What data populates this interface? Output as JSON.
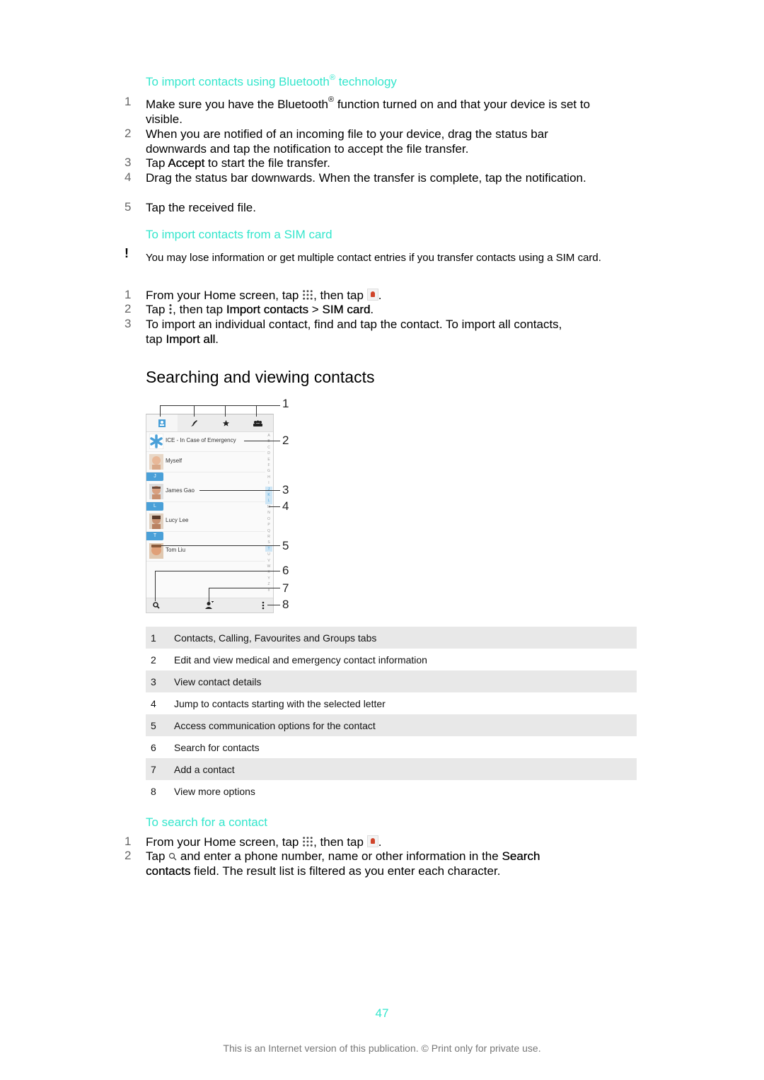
{
  "bluetooth_section": {
    "heading_pre": "To import contacts using Bluetooth",
    "heading_reg": "®",
    "heading_post": " technology",
    "steps": [
      {
        "num": "1",
        "pre": "Make sure you have the Bluetooth",
        "reg": "®",
        "post": " function turned on and that your device is set to visible."
      },
      {
        "num": "2",
        "text": "When you are notified of an incoming file to your device, drag the status bar downwards and tap the notification to accept the file transfer."
      },
      {
        "num": "3",
        "pre": "Tap ",
        "bold": "Accept",
        "post": " to start the file transfer."
      },
      {
        "num": "4",
        "text": "Drag the status bar downwards. When the transfer is complete, tap the notification."
      },
      {
        "num": "5",
        "text": "Tap the received file."
      }
    ]
  },
  "sim_section": {
    "heading": "To import contacts from a SIM card",
    "note_icon": "!",
    "note": "You may lose information or get multiple contact entries if you transfer contacts using a SIM card.",
    "steps": [
      {
        "num": "1",
        "pre": "From your Home screen, tap ",
        "mid": ", then tap ",
        "post": "."
      },
      {
        "num": "2",
        "pre": "Tap ",
        "mid": ", then tap ",
        "bold1": "Import contacts",
        "sep": " > ",
        "bold2": "SIM card",
        "post": "."
      },
      {
        "num": "3",
        "pre": "To import an individual contact, find and tap the contact. To import all contacts, tap ",
        "bold": "Import all",
        "post": "."
      }
    ]
  },
  "section_title": "Searching and viewing contacts",
  "phone": {
    "tabs": [
      "contacts-tab",
      "calling-tab",
      "favourites-tab",
      "groups-tab"
    ],
    "contacts": [
      {
        "name": "ICE - In Case of Emergency"
      },
      {
        "name": "Myself"
      },
      {
        "letter": "J"
      },
      {
        "name": "James Gao"
      },
      {
        "letter": "L"
      },
      {
        "name": "Lucy Lee"
      },
      {
        "letter": "T"
      },
      {
        "name": "Tom Liu"
      }
    ],
    "alphabet": [
      "A",
      "B",
      "C",
      "D",
      "E",
      "F",
      "G",
      "H",
      "I",
      "J",
      "K",
      "L",
      "M",
      "N",
      "O",
      "P",
      "Q",
      "R",
      "S",
      "T",
      "U",
      "V",
      "W",
      "X",
      "Y",
      "Z",
      "#"
    ],
    "callouts": [
      "1",
      "2",
      "3",
      "4",
      "5",
      "6",
      "7",
      "8"
    ]
  },
  "legend": [
    {
      "num": "1",
      "text": "Contacts, Calling, Favourites and Groups tabs"
    },
    {
      "num": "2",
      "text": "Edit and view medical and emergency contact information"
    },
    {
      "num": "3",
      "text": "View contact details"
    },
    {
      "num": "4",
      "text": "Jump to contacts starting with the selected letter"
    },
    {
      "num": "5",
      "text": "Access communication options for the contact"
    },
    {
      "num": "6",
      "text": "Search for contacts"
    },
    {
      "num": "7",
      "text": "Add a contact"
    },
    {
      "num": "8",
      "text": "View more options"
    }
  ],
  "search_section": {
    "heading": "To search for a contact",
    "steps": [
      {
        "num": "1",
        "pre": "From your Home screen, tap ",
        "mid": ", then tap ",
        "post": "."
      },
      {
        "num": "2",
        "pre": "Tap ",
        "mid": " and enter a phone number, name or other information in the ",
        "bold": "Search contacts",
        "post": " field. The result list is filtered as you enter each character."
      }
    ]
  },
  "page_number": "47",
  "footer": "This is an Internet version of this publication. © Print only for private use."
}
